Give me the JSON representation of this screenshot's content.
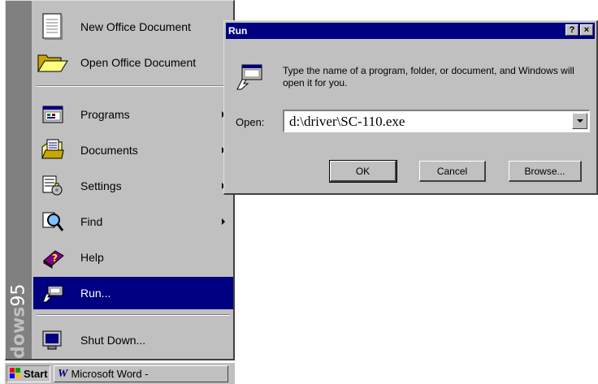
{
  "start_menu": {
    "side_band": {
      "brand_strong": "Windows",
      "brand_light": "95"
    },
    "top_items": [
      {
        "label": "New Office Document",
        "icon": "new-document-icon"
      },
      {
        "label": "Open Office Document",
        "icon": "open-folder-icon"
      }
    ],
    "items": [
      {
        "label": "Programs",
        "icon": "programs-icon",
        "submenu": true
      },
      {
        "label": "Documents",
        "icon": "documents-icon",
        "submenu": true
      },
      {
        "label": "Settings",
        "icon": "settings-icon",
        "submenu": true
      },
      {
        "label": "Find",
        "icon": "find-icon",
        "submenu": true
      },
      {
        "label": "Help",
        "icon": "help-icon",
        "submenu": false
      },
      {
        "label": "Run...",
        "icon": "run-icon",
        "submenu": false,
        "active": true
      }
    ],
    "shutdown": {
      "label": "Shut Down...",
      "icon": "shutdown-icon"
    }
  },
  "taskbar": {
    "start_label": "Start",
    "task_label": "Microsoft Word -"
  },
  "run_dialog": {
    "title": "Run",
    "help_button": "?",
    "close_button": "×",
    "description": "Type the name of a program, folder, or document, and Windows will open it for you.",
    "open_label": "Open:",
    "open_value": "d:\\driver\\SC-110.exe",
    "ok_label": "OK",
    "cancel_label": "Cancel",
    "browse_label": "Browse..."
  },
  "colors": {
    "face": "#c0c0c0",
    "highlight": "#000080",
    "band": "#808080"
  }
}
